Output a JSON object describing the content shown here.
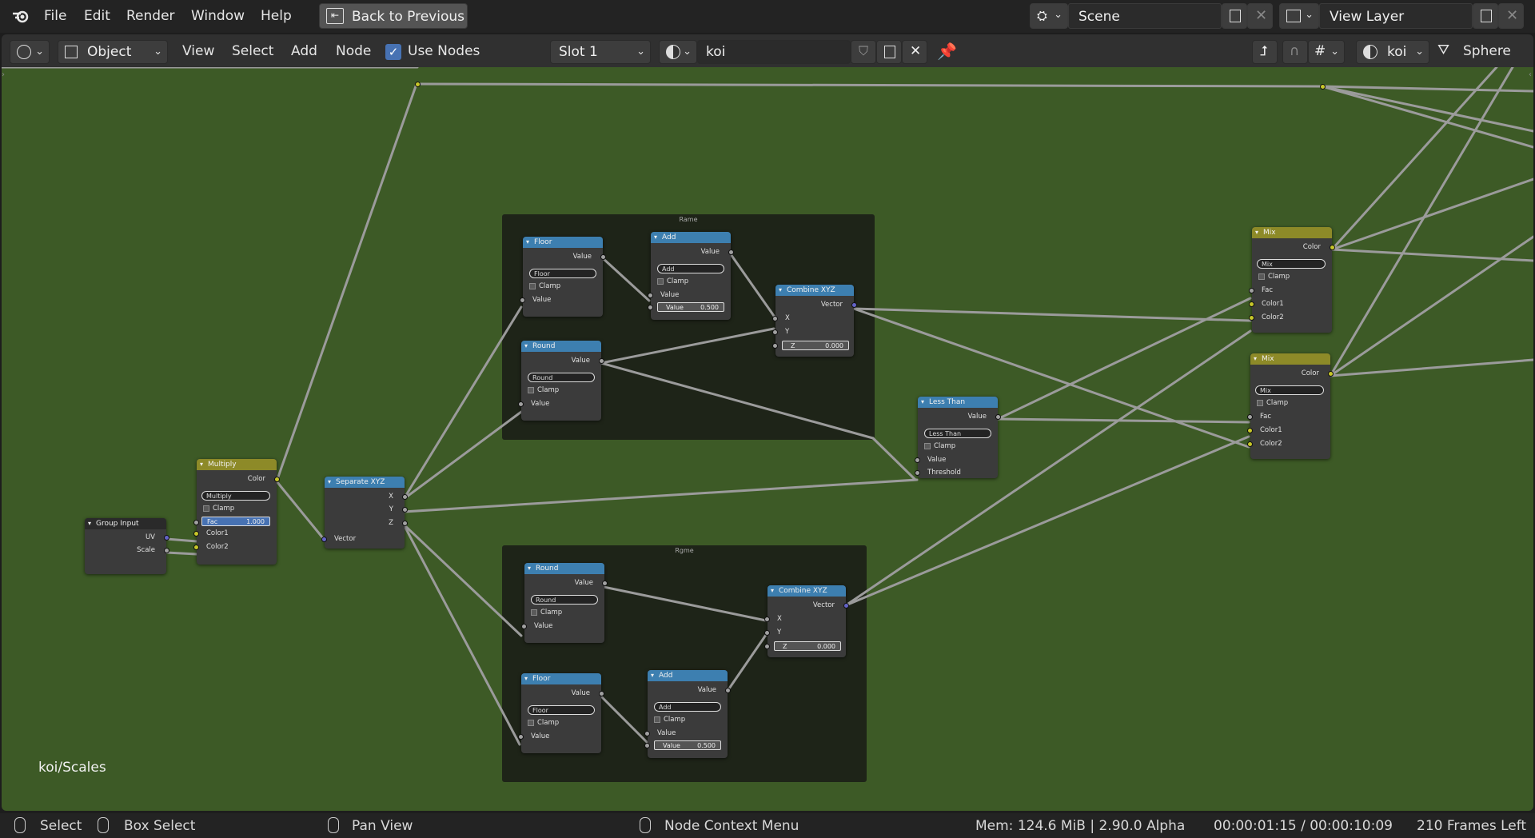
{
  "topbar": {
    "menu": [
      "File",
      "Edit",
      "Render",
      "Window",
      "Help"
    ],
    "back_button": "Back to Previous",
    "scene": "Scene",
    "view_layer": "View Layer"
  },
  "header": {
    "mode": "Object",
    "menus": [
      "View",
      "Select",
      "Add",
      "Node"
    ],
    "use_nodes": "Use Nodes",
    "slot": "Slot 1",
    "material": "koi",
    "pinned_material": "koi",
    "preview": "Sphere"
  },
  "editor": {
    "breadcrumb": "koi/Scales",
    "frames": {
      "top": "Rame",
      "bottom": "Rgme"
    }
  },
  "nodes": {
    "group_input": {
      "title": "Group Input",
      "out1": "UV",
      "out2": "Scale"
    },
    "multiply": {
      "title": "Multiply",
      "out": "Color",
      "op": "Multiply",
      "clamp": "Clamp",
      "fac_label": "Fac",
      "fac_value": "1.000",
      "in1": "Color1",
      "in2": "Color2"
    },
    "separate": {
      "title": "Separate XYZ",
      "x": "X",
      "y": "Y",
      "z": "Z",
      "in": "Vector"
    },
    "floor1": {
      "title": "Floor",
      "out": "Value",
      "op": "Floor",
      "clamp": "Clamp",
      "in": "Value"
    },
    "add1": {
      "title": "Add",
      "out": "Value",
      "op": "Add",
      "clamp": "Clamp",
      "in": "Value",
      "val_label": "Value",
      "val": "0.500"
    },
    "combine1": {
      "title": "Combine XYZ",
      "out": "Vector",
      "x": "X",
      "y": "Y",
      "z_label": "Z",
      "z": "0.000"
    },
    "round1": {
      "title": "Round",
      "out": "Value",
      "op": "Round",
      "clamp": "Clamp",
      "in": "Value"
    },
    "lessthan": {
      "title": "Less Than",
      "out": "Value",
      "op": "Less Than",
      "clamp": "Clamp",
      "in1": "Value",
      "in2": "Threshold"
    },
    "round2": {
      "title": "Round",
      "out": "Value",
      "op": "Round",
      "clamp": "Clamp",
      "in": "Value"
    },
    "combine2": {
      "title": "Combine XYZ",
      "out": "Vector",
      "x": "X",
      "y": "Y",
      "z_label": "Z",
      "z": "0.000"
    },
    "floor2": {
      "title": "Floor",
      "out": "Value",
      "op": "Floor",
      "clamp": "Clamp",
      "in": "Value"
    },
    "add2": {
      "title": "Add",
      "out": "Value",
      "op": "Add",
      "clamp": "Clamp",
      "in": "Value",
      "val_label": "Value",
      "val": "0.500"
    },
    "mix1": {
      "title": "Mix",
      "out": "Color",
      "op": "Mix",
      "clamp": "Clamp",
      "fac": "Fac",
      "c1": "Color1",
      "c2": "Color2"
    },
    "mix2": {
      "title": "Mix",
      "out": "Color",
      "op": "Mix",
      "clamp": "Clamp",
      "fac": "Fac",
      "c1": "Color1",
      "c2": "Color2"
    }
  },
  "status": {
    "select": "Select",
    "box_select": "Box Select",
    "pan_view": "Pan View",
    "context_menu": "Node Context Menu",
    "mem": "Mem: 124.6 MiB | 2.90.0 Alpha",
    "time": "00:00:01:15 / 00:00:10:09",
    "frames_left": "210 Frames Left"
  },
  "colors": {
    "editor_bg": "#3d5a26",
    "node_bg": "#3b3b3b",
    "header_blue": "#3d7fb0",
    "header_yellow": "#8d8a28",
    "wire": "#9b9b9b"
  }
}
